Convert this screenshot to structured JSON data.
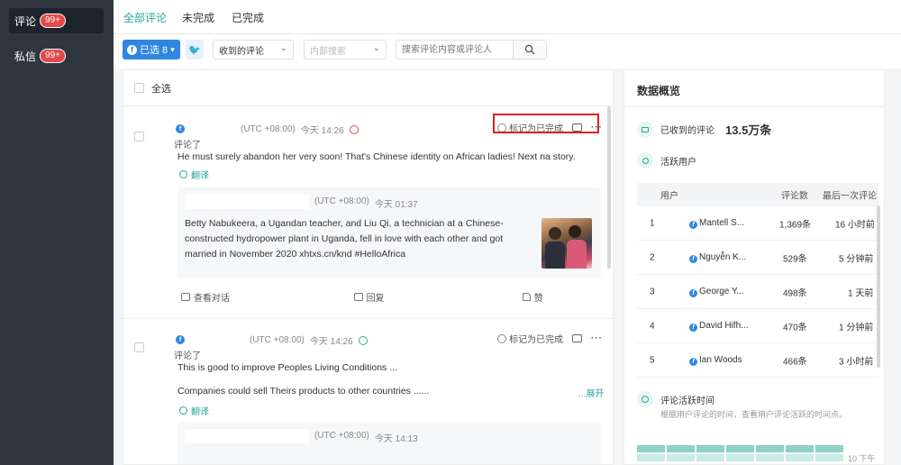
{
  "sidebar": {
    "items": [
      {
        "label": "评论",
        "badge": "99+",
        "active": true
      },
      {
        "label": "私信",
        "badge": "99+",
        "active": false
      }
    ]
  },
  "tabs": [
    {
      "label": "全部评论",
      "active": true
    },
    {
      "label": "未完成",
      "active": false
    },
    {
      "label": "已完成",
      "active": false
    }
  ],
  "toolbar": {
    "selected_label": "已选 8",
    "received_select": "收到的评论",
    "internal_placeholder": "内部搜索",
    "search_placeholder": "搜索评论内容或评论人"
  },
  "comments_panel": {
    "select_all": "全选",
    "comments": [
      {
        "action": "评论了",
        "timezone": "(UTC +08:00)",
        "time": "今天 14:26",
        "mood": "red",
        "mark_done": "标记为已完成",
        "text_lines": [
          "He must surely abandon her very soon! That's Chinese identity on African ladies! Next na story."
        ],
        "translate": "翻译",
        "quote": {
          "timezone": "(UTC +08:00)",
          "time": "今天 01:37",
          "text": "Betty Nabukeera, a Ugandan teacher, and Liu Qi, a technician at a Chinese-constructed hydropower plant in Uganda, fell in love with each other and got married in November 2020 xhtxs.cn/knd #HelloAfrica"
        },
        "footer": {
          "view_conversation": "查看对话",
          "reply": "回复",
          "like": "赞"
        }
      },
      {
        "action": "评论了",
        "timezone": "(UTC +08:00)",
        "time": "今天 14:26",
        "mood": "green",
        "mark_done": "标记为已完成",
        "text_lines": [
          "This is good to improve Peoples Living Conditions ...",
          "Companies could sell Theirs products to other countries ......"
        ],
        "expand": "...展开",
        "translate": "翻译",
        "quote": {
          "timezone": "(UTC +08:00)",
          "time": "今天 14:13"
        }
      }
    ]
  },
  "overview": {
    "title": "数据概览",
    "received_label": "已收到的评论",
    "received_value": "13.5万条",
    "active_users_label": "活跃用户",
    "table_headers": {
      "user": "用户",
      "count": "评论数",
      "last": "最后一次评论"
    },
    "users": [
      {
        "rank": "1",
        "name": "Mantell S...",
        "count": "1,369条",
        "last": "16 小时前"
      },
      {
        "rank": "2",
        "name": "Nguyễn K...",
        "count": "529条",
        "last": "5 分钟前"
      },
      {
        "rank": "3",
        "name": "George Y...",
        "count": "498条",
        "last": "1 天前"
      },
      {
        "rank": "4",
        "name": "David Hifh...",
        "count": "470条",
        "last": "1 分钟前"
      },
      {
        "rank": "5",
        "name": "Ian Woods",
        "count": "466条",
        "last": "3 小时前"
      }
    ],
    "activity_title": "评论活跃时间",
    "activity_sub": "根据用户评论的时间，查看用户评论活跃的时间点。",
    "heat_label": "10 下午"
  },
  "colors": {
    "accent": "#2aa59c",
    "primary": "#2f86e0",
    "badge": "#e54848",
    "highlight": "#e02020"
  }
}
